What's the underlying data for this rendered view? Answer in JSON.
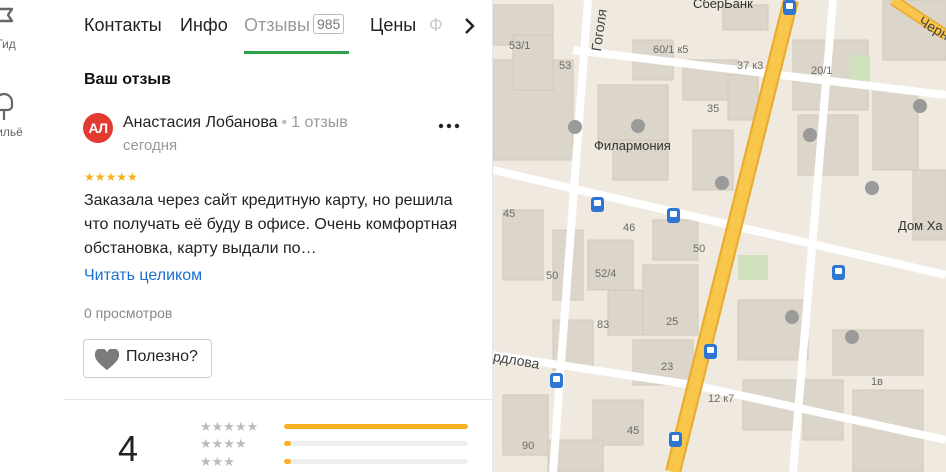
{
  "rail": {
    "guide_label": "Гид",
    "housing_label": "Жильё"
  },
  "tabs": [
    {
      "label": "Контакты"
    },
    {
      "label": "Инфо"
    },
    {
      "label": "Отзывы",
      "count": "985",
      "active": true
    },
    {
      "label": "Цены"
    },
    {
      "label": "Ф"
    }
  ],
  "review": {
    "section_title": "Ваш отзыв",
    "avatar_initials": "АЛ",
    "author": "Анастасия Лобанова",
    "author_reviews": "1 отзыв",
    "date": "сегодня",
    "stars": "★★★★★",
    "rating": 5,
    "text": "Заказала через сайт кредитную карту, но решила что получать её буду в офисе. Очень комфортная обстановка, карту выдали по…",
    "read_more": "Читать целиком",
    "views": "0 просмотров",
    "useful_label": "Полезно?"
  },
  "rating_summary": {
    "average": "4",
    "distribution": [
      {
        "stars": "★★★★★",
        "fraction": 1.0
      },
      {
        "stars": "★★★★",
        "fraction": 0.04
      },
      {
        "stars": "★★★",
        "fraction": 0.04
      }
    ]
  },
  "map": {
    "labels": {
      "sberbank": "СберБанк",
      "philharmonia": "Филармония",
      "gogol": "Гоголя",
      "sverdlova": "рдлова",
      "cherny": "Черн",
      "dom_ha": "Дом Ха",
      "h53_1": "53/1",
      "h53": "53",
      "h60_1k5": "60/1 к5",
      "h37k3": "37 к3",
      "h20_1": "20/1",
      "h35": "35",
      "h45a": "45",
      "h46": "46",
      "h50a": "50",
      "h50b": "50",
      "h52_4": "52/4",
      "h83": "83",
      "h25": "25",
      "h23": "23",
      "h12k7": "12 к7",
      "h1v": "1в",
      "h90": "90",
      "h45b": "45"
    },
    "colors": {
      "road_main": "#f7c64a",
      "road_main_edge": "#e9a92c",
      "bus_stop": "#2f76d2",
      "building": "#dcd6ca"
    }
  }
}
